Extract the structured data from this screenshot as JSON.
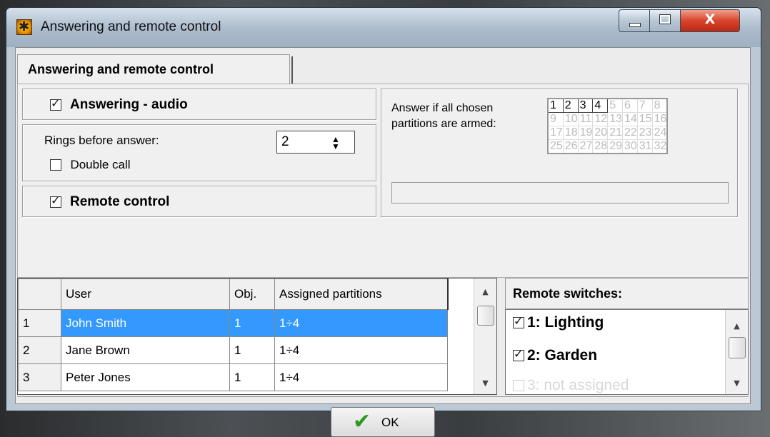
{
  "window": {
    "title": "Answering and remote control",
    "close_glyph": "X"
  },
  "tabs": [
    {
      "label": "Answering and remote control"
    }
  ],
  "answering": {
    "audio_label": "Answering - audio",
    "audio_checked": true,
    "rings_label": "Rings before answer:",
    "rings_value": "2",
    "double_call_label": "Double call",
    "double_call_checked": false,
    "remote_control_label": "Remote control",
    "remote_control_checked": true
  },
  "partitions": {
    "label_line1": "Answer if all chosen",
    "label_line2": "partitions are armed:",
    "rows": [
      [
        "1",
        "2",
        "3",
        "4",
        "5",
        "6",
        "7",
        "8"
      ],
      [
        "9",
        "10",
        "11",
        "12",
        "13",
        "14",
        "15",
        "16"
      ],
      [
        "17",
        "18",
        "19",
        "20",
        "21",
        "22",
        "23",
        "24"
      ],
      [
        "25",
        "26",
        "27",
        "28",
        "29",
        "30",
        "31",
        "32"
      ]
    ],
    "active": [
      "1",
      "2",
      "3",
      "4"
    ]
  },
  "users": {
    "columns": [
      "",
      "User",
      "Obj.",
      "Assigned partitions"
    ],
    "rows": [
      {
        "num": "1",
        "user": "John Smith",
        "obj": "1",
        "parts": "1÷4",
        "selected": true
      },
      {
        "num": "2",
        "user": "Jane Brown",
        "obj": "1",
        "parts": "1÷4",
        "selected": false
      },
      {
        "num": "3",
        "user": "Peter Jones",
        "obj": "1",
        "parts": "1÷4",
        "selected": false
      }
    ]
  },
  "remote_switches": {
    "header": "Remote switches:",
    "items": [
      {
        "label": "1: Lighting",
        "checked": true,
        "assigned": true
      },
      {
        "label": "2: Garden",
        "checked": true,
        "assigned": true
      },
      {
        "label": "3: not assigned",
        "checked": false,
        "assigned": false
      }
    ]
  },
  "buttons": {
    "ok": "OK"
  }
}
